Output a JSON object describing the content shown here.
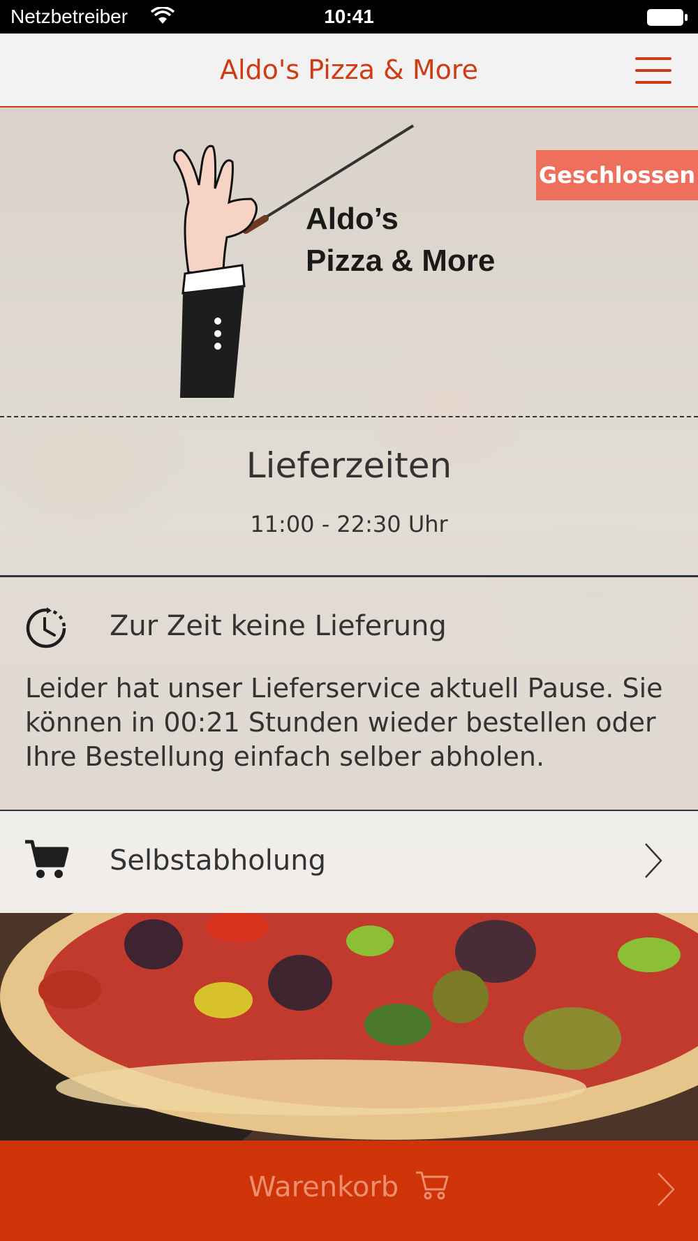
{
  "status_bar": {
    "carrier": "Netzbetreiber",
    "time": "10:41",
    "icons": [
      "wifi-icon",
      "battery-icon"
    ]
  },
  "nav": {
    "title": "Aldo's Pizza & More",
    "menu_icon": "hamburger-menu-icon"
  },
  "brand": {
    "logo_line1": "Aldo’s",
    "logo_line2": "Pizza & More",
    "accent_color": "#cf3b14",
    "badge_color": "#ee6f5b"
  },
  "status_badge": "Geschlossen",
  "delivery_times": {
    "title": "Lieferzeiten",
    "hours": "11:00 - 22:30 Uhr"
  },
  "delivery_notice": {
    "icon": "clock-icon",
    "title": "Zur Zeit keine Lieferung",
    "text": "Leider hat unser Lieferservice aktuell Pause. Sie können in 00:21 Stunden wieder bestellen oder Ihre Bestellung einfach selber abholen."
  },
  "pickup": {
    "icon": "cart-icon",
    "label": "Selbstabholung"
  },
  "cart_bar": {
    "label": "Warenkorb",
    "icon": "cart-icon"
  }
}
